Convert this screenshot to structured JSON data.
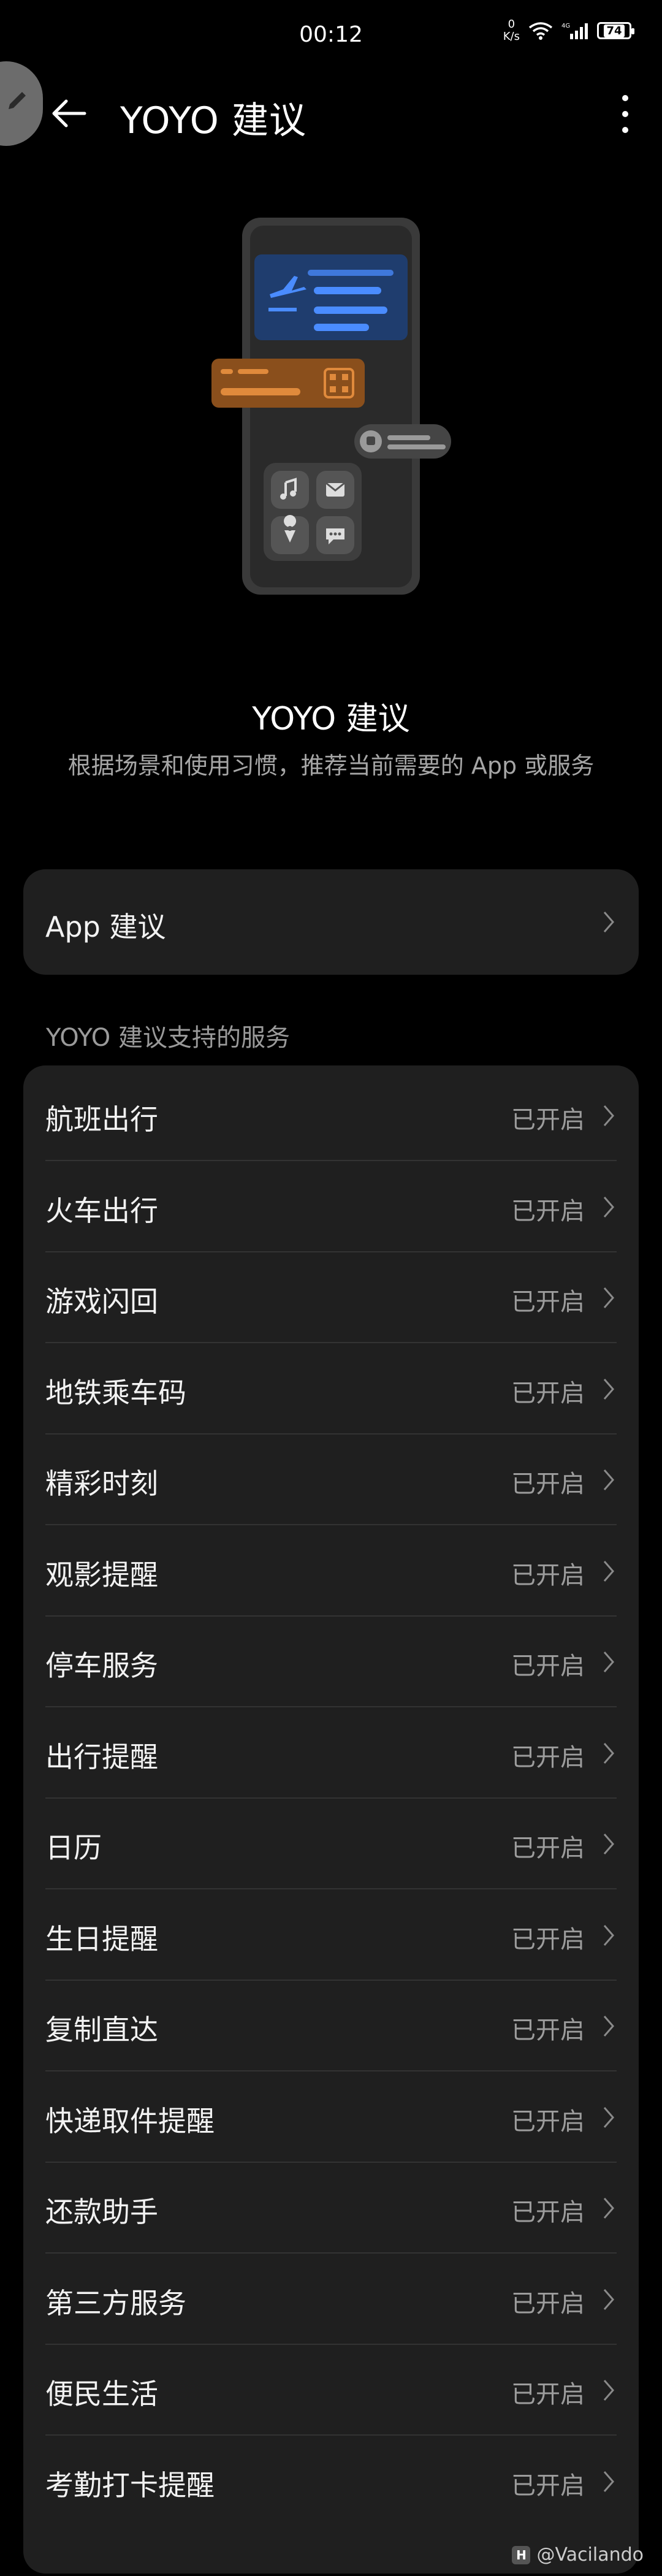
{
  "status_bar": {
    "time": "00:12",
    "net_speed_value": "0",
    "net_speed_unit": "K/s",
    "battery": "74"
  },
  "header": {
    "title": "YOYO 建议"
  },
  "hero": {
    "title": "YOYO 建议",
    "description": "根据场景和使用习惯，推荐当前需要的 App 或服务"
  },
  "app_suggestion": {
    "label": "App 建议"
  },
  "services": {
    "section_title": "YOYO 建议支持的服务",
    "items": [
      {
        "label": "航班出行",
        "status": "已开启"
      },
      {
        "label": "火车出行",
        "status": "已开启"
      },
      {
        "label": "游戏闪回",
        "status": "已开启"
      },
      {
        "label": "地铁乘车码",
        "status": "已开启"
      },
      {
        "label": "精彩时刻",
        "status": "已开启"
      },
      {
        "label": "观影提醒",
        "status": "已开启"
      },
      {
        "label": "停车服务",
        "status": "已开启"
      },
      {
        "label": "出行提醒",
        "status": "已开启"
      },
      {
        "label": "日历",
        "status": "已开启"
      },
      {
        "label": "生日提醒",
        "status": "已开启"
      },
      {
        "label": "复制直达",
        "status": "已开启"
      },
      {
        "label": "快递取件提醒",
        "status": "已开启"
      },
      {
        "label": "还款助手",
        "status": "已开启"
      },
      {
        "label": "第三方服务",
        "status": "已开启"
      },
      {
        "label": "便民生活",
        "status": "已开启"
      },
      {
        "label": "考勤打卡提醒",
        "status": "已开启"
      }
    ]
  },
  "watermark": {
    "text": "@Vacilando"
  },
  "colors": {
    "background": "#000000",
    "card": "#1f1f1f",
    "secondary_text": "#9c9c9c",
    "illustration_accent": "#e08a3c",
    "illustration_blue": "#2f6bd6"
  }
}
